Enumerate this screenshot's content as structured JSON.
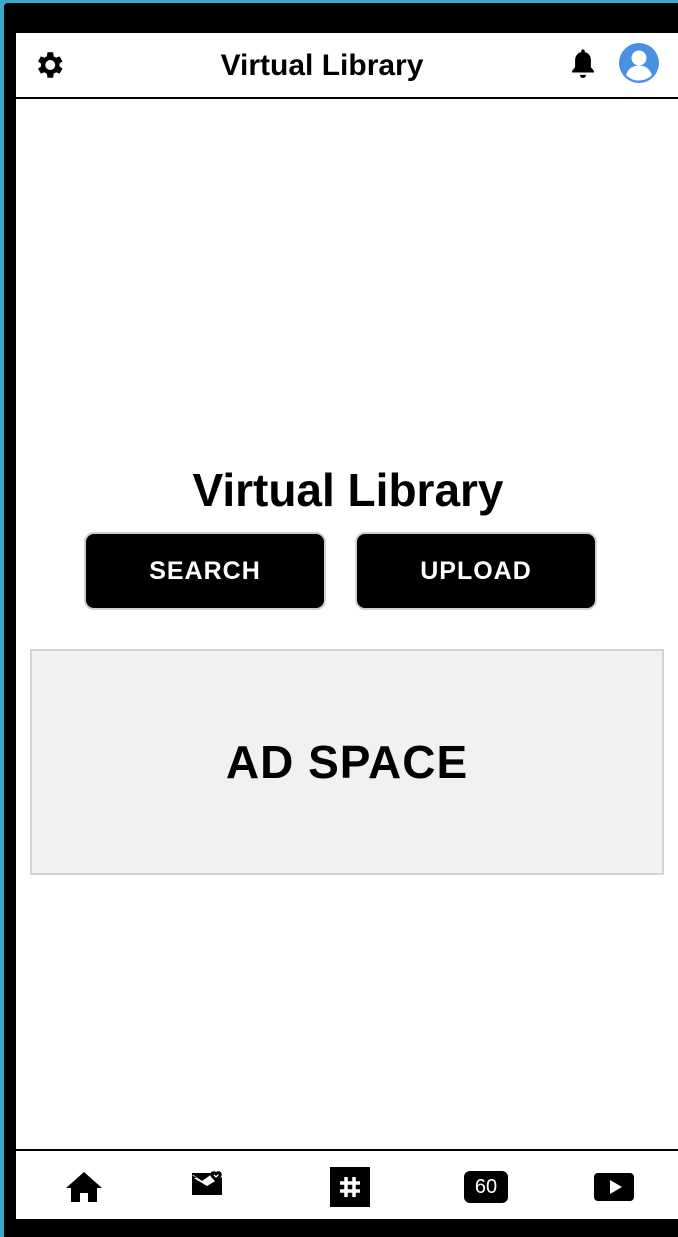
{
  "header": {
    "title": "Virtual Library",
    "left_icon": "gear-icon",
    "right_icons": [
      "bell-icon",
      "user-avatar-icon"
    ]
  },
  "main": {
    "title": "Virtual Library",
    "search_label": "SEARCH",
    "upload_label": "UPLOAD",
    "ad_label": "AD SPACE"
  },
  "bottom_nav": {
    "items": [
      {
        "icon": "home-icon"
      },
      {
        "icon": "mail-heart-icon"
      },
      {
        "icon": "hashtag-icon"
      },
      {
        "icon": "sixty-badge-icon",
        "label": "60"
      },
      {
        "icon": "play-icon"
      }
    ]
  },
  "colors": {
    "background": "#3aa9c6",
    "frame": "#000000",
    "avatar": "#4a90e2",
    "ad_bg": "#f1f1f1"
  }
}
